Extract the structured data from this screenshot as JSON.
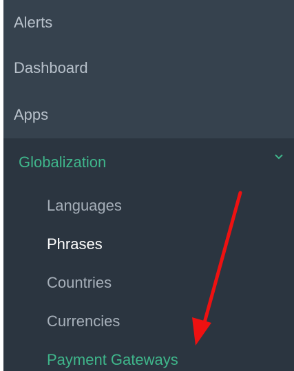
{
  "sidebar": {
    "top_items": [
      {
        "label": "Alerts"
      },
      {
        "label": "Dashboard"
      },
      {
        "label": "Apps"
      }
    ],
    "expanded_item": {
      "label": "Globalization",
      "icon": "chevron-down-icon"
    },
    "sub_items": [
      {
        "label": "Languages"
      },
      {
        "label": "Phrases"
      },
      {
        "label": "Countries"
      },
      {
        "label": "Currencies"
      },
      {
        "label": "Payment Gateways"
      }
    ]
  },
  "colors": {
    "sidebar_bg": "#2b3540",
    "top_items_bg": "#36424e",
    "accent": "#3fb68b",
    "annotation_arrow": "#ee1111"
  }
}
